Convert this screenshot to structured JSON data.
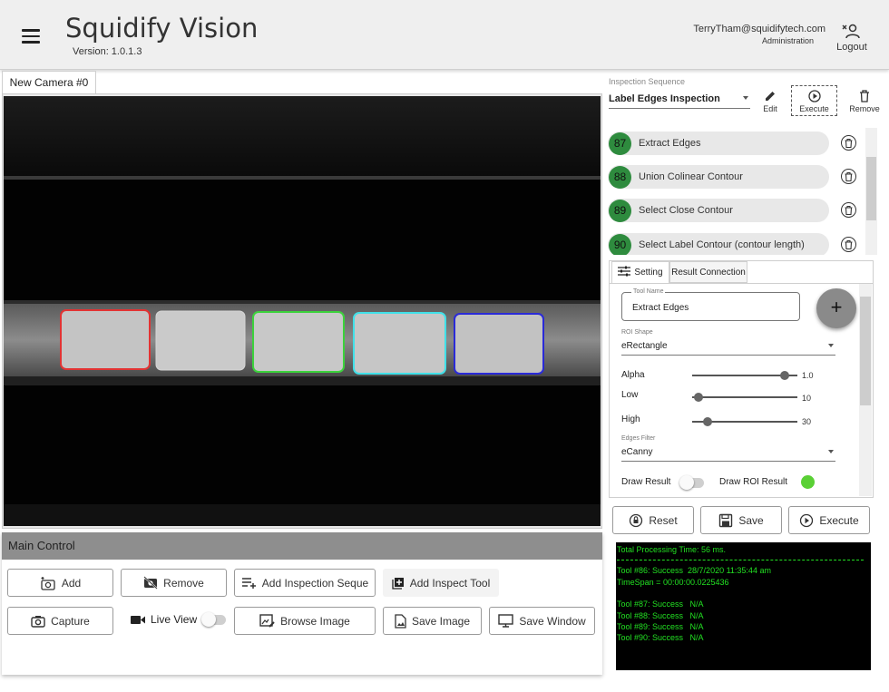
{
  "header": {
    "title": "Squidify Vision",
    "version": "Version: 1.0.1.3",
    "user_email": "TerryTham@squidifytech.com",
    "user_role": "Administration",
    "logout_label": "Logout"
  },
  "camera": {
    "tab_label": "New Camera #0",
    "labels": [
      {
        "color": "#e23333"
      },
      {
        "color": "#d6d6d6"
      },
      {
        "color": "#3cd23c"
      },
      {
        "color": "#40e0e8"
      },
      {
        "color": "#2a2ad8"
      }
    ]
  },
  "main_control": {
    "title": "Main Control",
    "add_label": "Add",
    "remove_label": "Remove",
    "add_sequence_label": "Add Inspection Seque",
    "add_tool_label": "Add Inspect Tool",
    "capture_label": "Capture",
    "live_view_label": "Live View",
    "browse_label": "Browse Image",
    "save_image_label": "Save Image",
    "save_window_label": "Save Window"
  },
  "inspection": {
    "caption": "Inspection Sequence",
    "selected": "Label Edges Inspection",
    "edit_label": "Edit",
    "execute_label": "Execute",
    "remove_label": "Remove",
    "steps": [
      {
        "num": "87",
        "label": "Extract Edges"
      },
      {
        "num": "88",
        "label": "Union Colinear Contour"
      },
      {
        "num": "89",
        "label": "Select Close Contour"
      },
      {
        "num": "90",
        "label": "Select Label Contour (contour length)"
      }
    ]
  },
  "tool_panel": {
    "tab_setting": "Setting",
    "tab_result": "Result Connection",
    "tool_name_caption": "Tool Name",
    "tool_name": "Extract Edges",
    "add_symbol": "+",
    "roi_caption": "ROI Shape",
    "roi_value": "eRectangle",
    "alpha_label": "Alpha",
    "alpha_value": "1.0",
    "low_label": "Low",
    "low_value": "10",
    "high_label": "High",
    "high_value": "30",
    "edges_caption": "Edges Filter",
    "edges_value": "eCanny",
    "draw_result_label": "Draw Result",
    "draw_roi_label": "Draw ROI Result",
    "sliders": {
      "alpha": 0.88,
      "low": 0.06,
      "high": 0.15
    },
    "draw_roi_color": "#5ad035"
  },
  "actions": {
    "reset_label": "Reset",
    "save_label": "Save",
    "execute_label": "Execute"
  },
  "console": {
    "header": "Total Processing Time: 56 ms.",
    "lines": [
      "Tool #86: Success  28/7/2020 11:35:44 am",
      "TimeSpan = 00:00:00.0225436",
      "",
      "Tool #87: Success   N/A",
      "Tool #88: Success   N/A",
      "Tool #89: Success   N/A",
      "Tool #90: Success   N/A"
    ],
    "text_color": "#22e022"
  }
}
